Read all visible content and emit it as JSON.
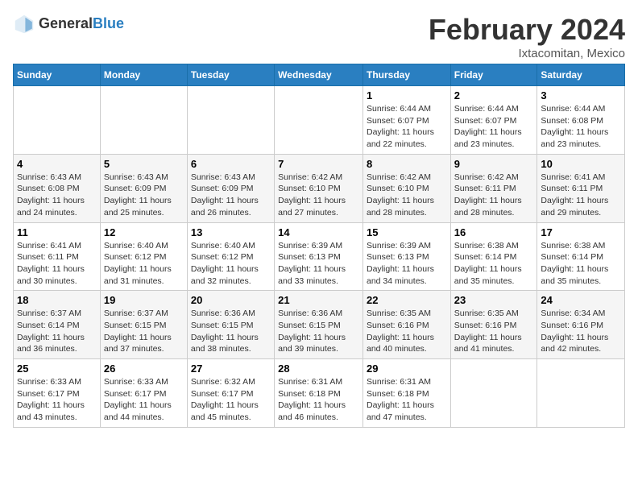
{
  "header": {
    "logo_general": "General",
    "logo_blue": "Blue",
    "month_title": "February 2024",
    "location": "Ixtacomitan, Mexico"
  },
  "days_of_week": [
    "Sunday",
    "Monday",
    "Tuesday",
    "Wednesday",
    "Thursday",
    "Friday",
    "Saturday"
  ],
  "weeks": [
    [
      {
        "day": "",
        "info": ""
      },
      {
        "day": "",
        "info": ""
      },
      {
        "day": "",
        "info": ""
      },
      {
        "day": "",
        "info": ""
      },
      {
        "day": "1",
        "info": "Sunrise: 6:44 AM\nSunset: 6:07 PM\nDaylight: 11 hours and 22 minutes."
      },
      {
        "day": "2",
        "info": "Sunrise: 6:44 AM\nSunset: 6:07 PM\nDaylight: 11 hours and 23 minutes."
      },
      {
        "day": "3",
        "info": "Sunrise: 6:44 AM\nSunset: 6:08 PM\nDaylight: 11 hours and 23 minutes."
      }
    ],
    [
      {
        "day": "4",
        "info": "Sunrise: 6:43 AM\nSunset: 6:08 PM\nDaylight: 11 hours and 24 minutes."
      },
      {
        "day": "5",
        "info": "Sunrise: 6:43 AM\nSunset: 6:09 PM\nDaylight: 11 hours and 25 minutes."
      },
      {
        "day": "6",
        "info": "Sunrise: 6:43 AM\nSunset: 6:09 PM\nDaylight: 11 hours and 26 minutes."
      },
      {
        "day": "7",
        "info": "Sunrise: 6:42 AM\nSunset: 6:10 PM\nDaylight: 11 hours and 27 minutes."
      },
      {
        "day": "8",
        "info": "Sunrise: 6:42 AM\nSunset: 6:10 PM\nDaylight: 11 hours and 28 minutes."
      },
      {
        "day": "9",
        "info": "Sunrise: 6:42 AM\nSunset: 6:11 PM\nDaylight: 11 hours and 28 minutes."
      },
      {
        "day": "10",
        "info": "Sunrise: 6:41 AM\nSunset: 6:11 PM\nDaylight: 11 hours and 29 minutes."
      }
    ],
    [
      {
        "day": "11",
        "info": "Sunrise: 6:41 AM\nSunset: 6:11 PM\nDaylight: 11 hours and 30 minutes."
      },
      {
        "day": "12",
        "info": "Sunrise: 6:40 AM\nSunset: 6:12 PM\nDaylight: 11 hours and 31 minutes."
      },
      {
        "day": "13",
        "info": "Sunrise: 6:40 AM\nSunset: 6:12 PM\nDaylight: 11 hours and 32 minutes."
      },
      {
        "day": "14",
        "info": "Sunrise: 6:39 AM\nSunset: 6:13 PM\nDaylight: 11 hours and 33 minutes."
      },
      {
        "day": "15",
        "info": "Sunrise: 6:39 AM\nSunset: 6:13 PM\nDaylight: 11 hours and 34 minutes."
      },
      {
        "day": "16",
        "info": "Sunrise: 6:38 AM\nSunset: 6:14 PM\nDaylight: 11 hours and 35 minutes."
      },
      {
        "day": "17",
        "info": "Sunrise: 6:38 AM\nSunset: 6:14 PM\nDaylight: 11 hours and 35 minutes."
      }
    ],
    [
      {
        "day": "18",
        "info": "Sunrise: 6:37 AM\nSunset: 6:14 PM\nDaylight: 11 hours and 36 minutes."
      },
      {
        "day": "19",
        "info": "Sunrise: 6:37 AM\nSunset: 6:15 PM\nDaylight: 11 hours and 37 minutes."
      },
      {
        "day": "20",
        "info": "Sunrise: 6:36 AM\nSunset: 6:15 PM\nDaylight: 11 hours and 38 minutes."
      },
      {
        "day": "21",
        "info": "Sunrise: 6:36 AM\nSunset: 6:15 PM\nDaylight: 11 hours and 39 minutes."
      },
      {
        "day": "22",
        "info": "Sunrise: 6:35 AM\nSunset: 6:16 PM\nDaylight: 11 hours and 40 minutes."
      },
      {
        "day": "23",
        "info": "Sunrise: 6:35 AM\nSunset: 6:16 PM\nDaylight: 11 hours and 41 minutes."
      },
      {
        "day": "24",
        "info": "Sunrise: 6:34 AM\nSunset: 6:16 PM\nDaylight: 11 hours and 42 minutes."
      }
    ],
    [
      {
        "day": "25",
        "info": "Sunrise: 6:33 AM\nSunset: 6:17 PM\nDaylight: 11 hours and 43 minutes."
      },
      {
        "day": "26",
        "info": "Sunrise: 6:33 AM\nSunset: 6:17 PM\nDaylight: 11 hours and 44 minutes."
      },
      {
        "day": "27",
        "info": "Sunrise: 6:32 AM\nSunset: 6:17 PM\nDaylight: 11 hours and 45 minutes."
      },
      {
        "day": "28",
        "info": "Sunrise: 6:31 AM\nSunset: 6:18 PM\nDaylight: 11 hours and 46 minutes."
      },
      {
        "day": "29",
        "info": "Sunrise: 6:31 AM\nSunset: 6:18 PM\nDaylight: 11 hours and 47 minutes."
      },
      {
        "day": "",
        "info": ""
      },
      {
        "day": "",
        "info": ""
      }
    ]
  ]
}
